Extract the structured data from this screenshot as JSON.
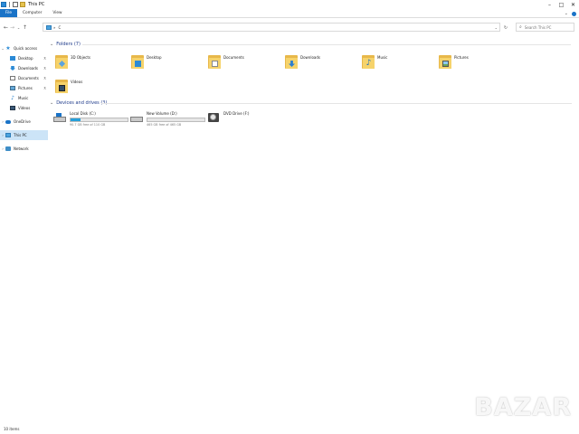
{
  "window": {
    "title": "This PC",
    "controls": {
      "minimize": "–",
      "maximize": "□",
      "close": "✕"
    }
  },
  "ribbon": {
    "tabs": [
      "File",
      "Computer",
      "View"
    ],
    "expand_glyph": "⌄",
    "help_icon": "help-icon"
  },
  "nav": {
    "back": "←",
    "forward": "→",
    "recent": "⌄",
    "up": "↑",
    "address_separator": "»",
    "address_location": "C",
    "address_dropdown": "⌄",
    "refresh": "↻"
  },
  "search": {
    "placeholder": "Search This PC",
    "icon": "⌕"
  },
  "sidebar": {
    "items": [
      {
        "label": "Quick access",
        "icon": "star-icon",
        "expander": "⌄",
        "pinned": false,
        "selected": false
      },
      {
        "label": "Desktop",
        "icon": "desktop-icon",
        "pinned": true,
        "selected": false
      },
      {
        "label": "Downloads",
        "icon": "downloads-icon",
        "pinned": true,
        "selected": false
      },
      {
        "label": "Documents",
        "icon": "documents-icon",
        "pinned": true,
        "selected": false
      },
      {
        "label": "Pictures",
        "icon": "pictures-icon",
        "pinned": true,
        "selected": false
      },
      {
        "label": "Music",
        "icon": "music-icon",
        "pinned": false,
        "selected": false
      },
      {
        "label": "Videos",
        "icon": "videos-icon",
        "pinned": false,
        "selected": false
      },
      {
        "label": "OneDrive",
        "icon": "onedrive-icon",
        "expander": "›",
        "pinned": false,
        "selected": false
      },
      {
        "label": "This PC",
        "icon": "this-pc-icon",
        "expander": "›",
        "pinned": false,
        "selected": true
      },
      {
        "label": "Network",
        "icon": "network-icon",
        "expander": "›",
        "pinned": false,
        "selected": false
      }
    ],
    "pin_glyph": "⊼"
  },
  "folders": {
    "header": "Folders (7)",
    "chevron": "⌄",
    "items": [
      {
        "label": "3D Objects",
        "icon": "3d-objects-icon"
      },
      {
        "label": "Desktop",
        "icon": "desktop-icon"
      },
      {
        "label": "Documents",
        "icon": "documents-icon"
      },
      {
        "label": "Downloads",
        "icon": "downloads-icon"
      },
      {
        "label": "Music",
        "icon": "music-icon"
      },
      {
        "label": "Pictures",
        "icon": "pictures-icon"
      },
      {
        "label": "Videos",
        "icon": "videos-icon"
      }
    ]
  },
  "drives": {
    "header": "Devices and drives (3)",
    "chevron": "⌄",
    "items": [
      {
        "name": "Local Disk (C:)",
        "free": "90.7 GB free of 110 GB",
        "used_fraction": 0.18,
        "icon": "local-disk-icon",
        "bar_color": "#26a0da"
      },
      {
        "name": "New Volume (D:)",
        "free": "465 GB free of 465 GB",
        "used_fraction": 0.0,
        "icon": "hard-drive-icon",
        "bar_color": "#26a0da"
      },
      {
        "name": "DVD Drive (F:)",
        "icon": "dvd-drive-icon"
      }
    ]
  },
  "status": {
    "items_count": "10 items"
  },
  "watermark": "BAZAR"
}
